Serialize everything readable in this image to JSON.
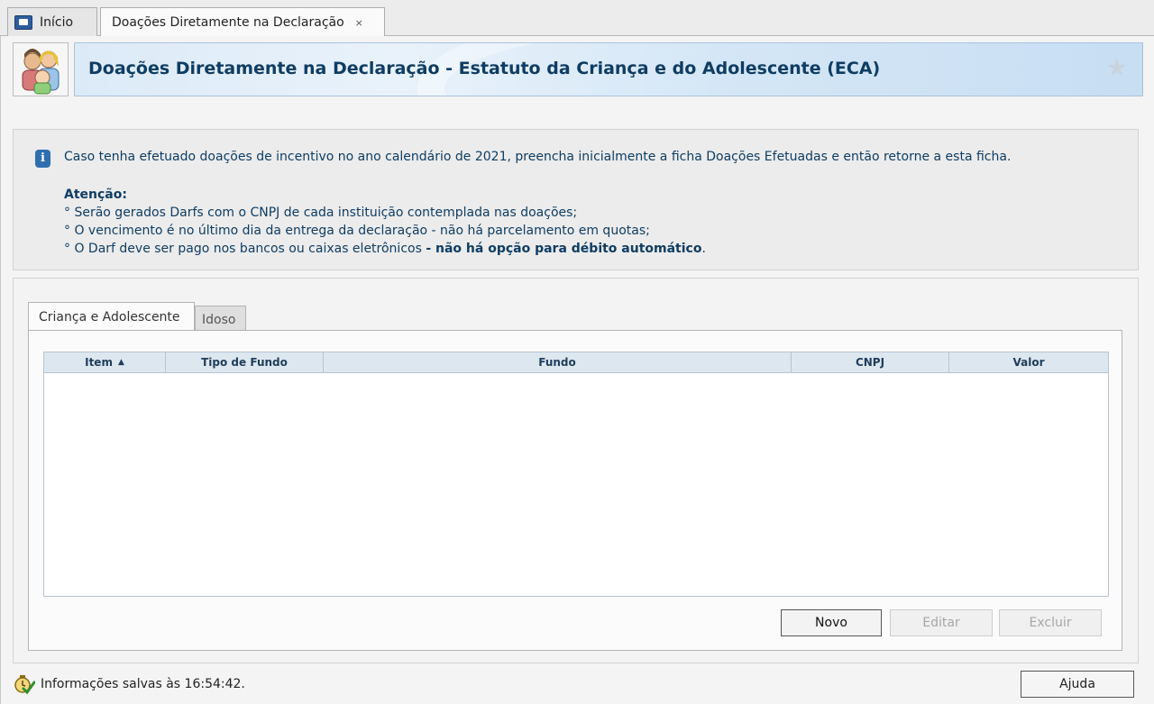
{
  "window_tabs": [
    {
      "label": "Início",
      "icon": "home-icon"
    },
    {
      "label": "Doações Diretamente na Declaração",
      "close": "×"
    }
  ],
  "header": {
    "title": "Doações Diretamente na Declaração - Estatuto da Criança e do Adolescente (ECA)",
    "icon": "children-icon",
    "favorite_icon": "star-icon"
  },
  "info": {
    "main_text": "Caso tenha efetuado doações de incentivo no ano calendário de 2021, preencha inicialmente a ficha Doações Efetuadas e então retorne a esta ficha.",
    "attention_title": "Atenção:",
    "bullets": [
      "° Serão gerados Darfs com o CNPJ de cada instituição contemplada nas doações;",
      "° O vencimento é no último dia da entrega da declaração - não há parcelamento em quotas;"
    ],
    "bullet3_prefix": "° O Darf deve ser pago nos bancos ou caixas eletrônicos ",
    "bullet3_bold": "- não há opção para débito automático",
    "bullet3_suffix": "."
  },
  "inner_tabs": [
    {
      "label": "Criança e Adolescente",
      "active": true
    },
    {
      "label": "Idoso",
      "active": false
    }
  ],
  "table": {
    "columns": [
      "Item",
      "Tipo de Fundo",
      "Fundo",
      "CNPJ",
      "Valor"
    ],
    "sort_column": "Item",
    "sort_direction": "ascending",
    "rows": []
  },
  "buttons": {
    "novo": "Novo",
    "editar": "Editar",
    "excluir": "Excluir"
  },
  "status": {
    "text": "Informações salvas às 16:54:42.",
    "icon": "saved-clock-icon"
  },
  "help_button": "Ajuda"
}
